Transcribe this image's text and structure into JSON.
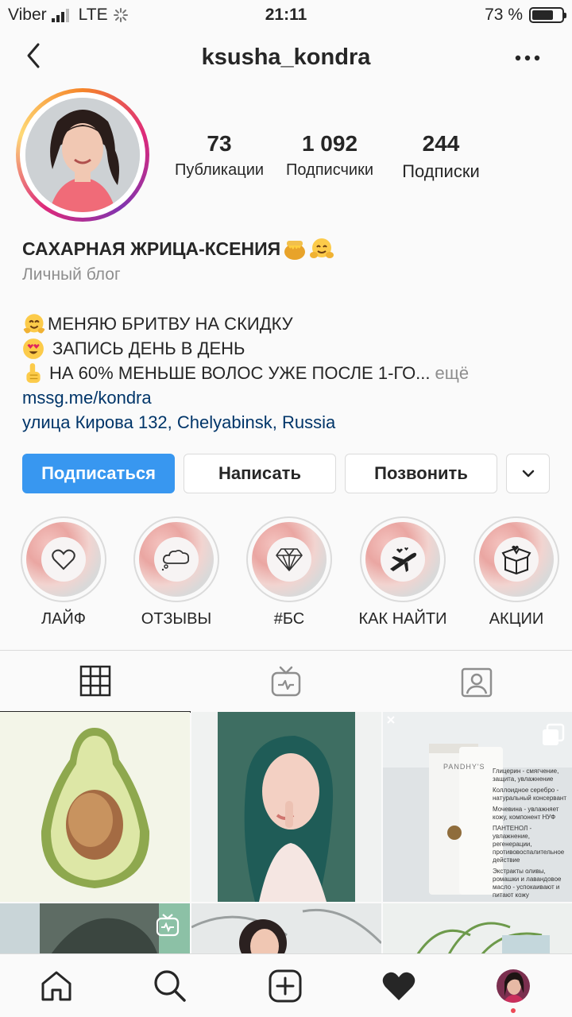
{
  "status_bar": {
    "carrier": "Viber",
    "network": "LTE",
    "time": "21:11",
    "battery": "73 %",
    "battery_level": 0.73
  },
  "header": {
    "username": "ksusha_kondra"
  },
  "profile": {
    "stats": [
      {
        "value": "73",
        "label": "Публикации"
      },
      {
        "value": "1 092",
        "label": "Подписчики"
      },
      {
        "value": "244",
        "label": "Подписки"
      }
    ],
    "name": "САХАРНАЯ ЖРИЦА-КСЕНИЯ",
    "category": "Личный блог",
    "bio_lines": [
      "МЕНЯЮ БРИТВУ НА СКИДКУ",
      "ЗАПИСЬ ДЕНЬ В ДЕНЬ",
      "НА 60% МЕНЬШЕ ВОЛОС УЖЕ ПОСЛЕ 1-ГО..."
    ],
    "more_label": "ещё",
    "link": "mssg.me/kondra",
    "address": "улица Кирова 132, Chelyabinsk, Russia"
  },
  "buttons": {
    "follow": "Подписаться",
    "message": "Написать",
    "call": "Позвонить"
  },
  "highlights": [
    {
      "label": "ЛАЙФ",
      "icon": "heart-icon"
    },
    {
      "label": "ОТЗЫВЫ",
      "icon": "speech-cloud-icon"
    },
    {
      "label": "#БС",
      "icon": "diamond-icon"
    },
    {
      "label": "КАК НАЙТИ",
      "icon": "airplane-icon"
    },
    {
      "label": "АКЦИИ",
      "icon": "gift-box-icon"
    }
  ],
  "product_post": {
    "brand": "PANDHY'S",
    "lines": [
      "Глицерин - смягчение, защита, увлажнение",
      "Коллоидное серебро - натуральный консервант",
      "Мочевина - увлажняет кожу, компонент НУФ",
      "ПАНТЕНОЛ - увлажнение, регенерации, противовоспалительное действие",
      "Экстракты оливы, ромашки и лавандовое масло - успокаивают и питают кожу"
    ]
  },
  "colors": {
    "accent": "#3897f0",
    "link": "#003569",
    "text": "#262626",
    "muted": "#8e8e8e",
    "border": "#dbdbdb"
  }
}
